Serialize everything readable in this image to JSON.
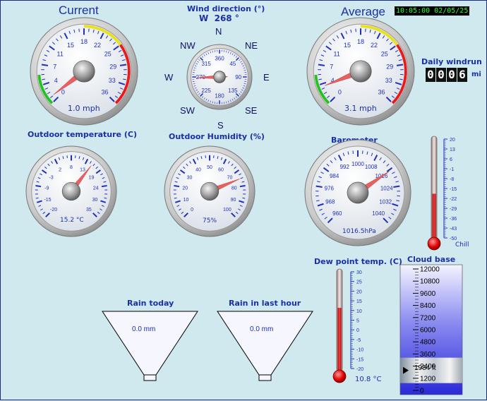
{
  "header": {
    "current_label": "Current",
    "average_label": "Average",
    "datetime": "10:05:00 02/05/25"
  },
  "wind_direction": {
    "title": "Wind direction (°)",
    "value_text": "W  268 °",
    "value": 268,
    "compass": {
      "n": "N",
      "ne": "NE",
      "e": "E",
      "se": "SE",
      "s": "S",
      "sw": "SW",
      "w": "W",
      "nw": "NW"
    },
    "ticks": [
      "360",
      "45",
      "90",
      "135",
      "180",
      "225",
      "270",
      "315"
    ]
  },
  "daily_windrun": {
    "title": "Daily windrun",
    "digits": [
      "0",
      "0",
      "0",
      "6"
    ],
    "unit": "mi"
  },
  "gauges": {
    "current": {
      "ticks": [
        "0",
        "4",
        "7",
        "11",
        "15",
        "18",
        "22",
        "25",
        "29",
        "33",
        "36"
      ],
      "value": 1.0,
      "min": 0,
      "max": 36,
      "readout": "1.0 mph"
    },
    "average": {
      "ticks": [
        "0",
        "4",
        "7",
        "11",
        "15",
        "18",
        "22",
        "25",
        "29",
        "33",
        "36"
      ],
      "value": 3.1,
      "min": 0,
      "max": 36,
      "readout": "3.1 mph"
    },
    "temperature": {
      "title": "Outdoor temperature (C)",
      "ticks": [
        "-20",
        "-15",
        "-9",
        "-3",
        "2",
        "8",
        "13",
        "19",
        "24",
        "30",
        "35"
      ],
      "value": 15.2,
      "min": -20,
      "max": 35,
      "readout": "15.2 °C"
    },
    "humidity": {
      "title": "Outdoor Humidity (%)",
      "ticks": [
        "0",
        "10",
        "20",
        "30",
        "40",
        "50",
        "60",
        "70",
        "80",
        "90",
        "100"
      ],
      "value": 75,
      "min": 0,
      "max": 100,
      "readout": "75%"
    },
    "barometer": {
      "title": "Barometer",
      "ticks": [
        "960",
        "968",
        "976",
        "984",
        "992",
        "1000",
        "1008",
        "1016",
        "1024",
        "1032",
        "1040"
      ],
      "value": 1016.5,
      "min": 960,
      "max": 1040,
      "readout": "1016.5hPa"
    }
  },
  "chill": {
    "label": "Chill",
    "scale": [
      "20",
      "13",
      "6",
      "-1",
      "-8",
      "-15",
      "-22",
      "-29",
      "-36",
      "-43",
      "-50"
    ],
    "level": 0.45
  },
  "dewpoint": {
    "title": "Dew point temp. (C)",
    "scale": [
      "30",
      "25",
      "20",
      "15",
      "10",
      "5",
      "0",
      "-5",
      "-10",
      "-15",
      "-20"
    ],
    "level": 0.62,
    "readout": "10.8 °C"
  },
  "cloud_base": {
    "title": "Cloud base",
    "scale": [
      "12000",
      "10800",
      "9600",
      "8400",
      "7200",
      "6000",
      "4800",
      "3600",
      "2400",
      "1200",
      "0"
    ],
    "value_text": "1984 ft",
    "level": 0.165
  },
  "rain": {
    "today_title": "Rain today",
    "today_value": "0.0 mm",
    "hour_title": "Rain in last hour",
    "hour_value": "0.0 mm"
  },
  "colors": {
    "label_blue": "#1a2fa8",
    "needle": "#e86060",
    "zone_green": "#22c41a",
    "zone_yellow": "#e8e21a",
    "zone_red": "#e81a1a"
  }
}
